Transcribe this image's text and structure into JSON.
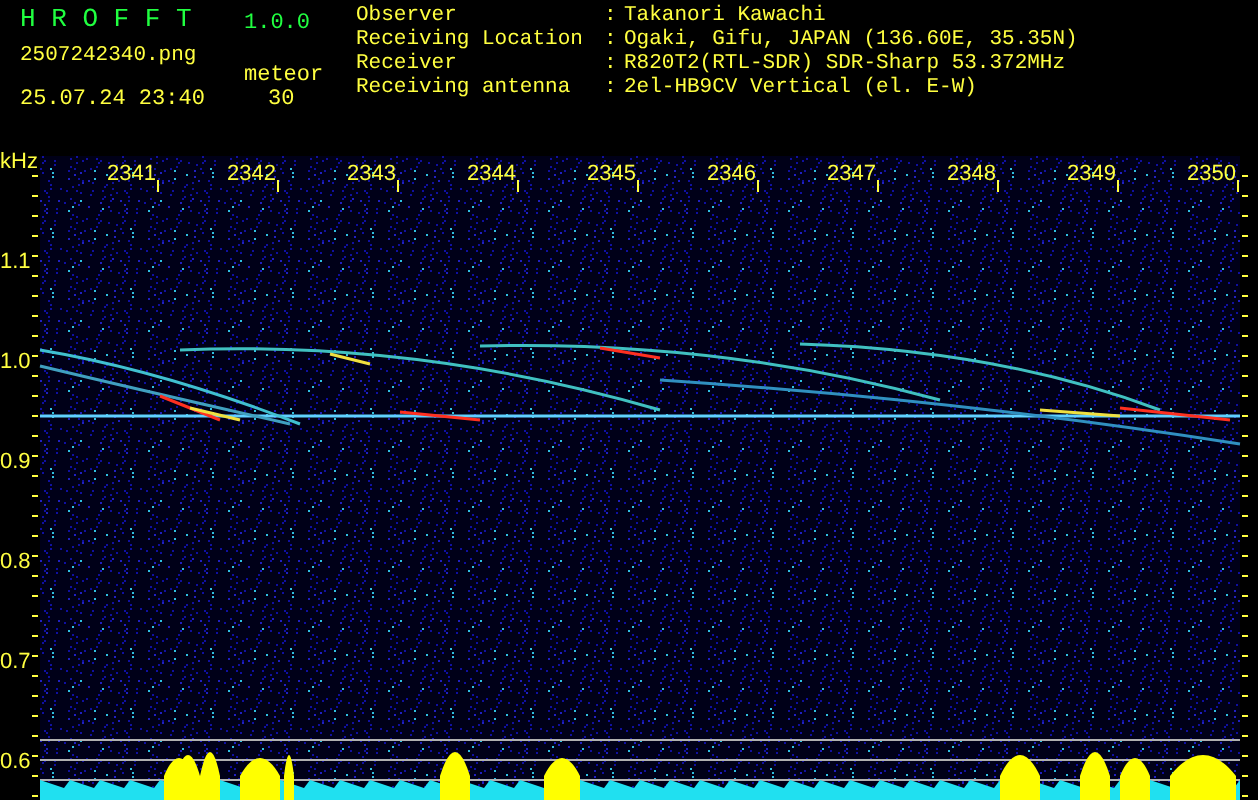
{
  "app": {
    "name": "H R O F F T",
    "version": "1.0.0"
  },
  "file": {
    "name": "2507242340.png",
    "datetime": "25.07.24 23:40"
  },
  "count": {
    "label": "meteor",
    "value": "30"
  },
  "station": [
    {
      "label": "Observer",
      "value": "Takanori Kawachi"
    },
    {
      "label": "Receiving Location",
      "value": "Ogaki, Gifu, JAPAN (136.60E, 35.35N)"
    },
    {
      "label": "Receiver",
      "value": "R820T2(RTL-SDR) SDR-Sharp 53.372MHz"
    },
    {
      "label": "Receiving antenna",
      "value": "2el-HB9CV Vertical (el. E-W)"
    }
  ],
  "separator": ":",
  "spectrogram": {
    "unit": "kHz",
    "x_labels": [
      "2341",
      "2342",
      "2343",
      "2344",
      "2345",
      "2346",
      "2347",
      "2348",
      "2349",
      "2350"
    ],
    "y_labels": [
      "1.1",
      "1.0",
      "0.9",
      "0.8",
      "0.7",
      "0.6"
    ]
  }
}
